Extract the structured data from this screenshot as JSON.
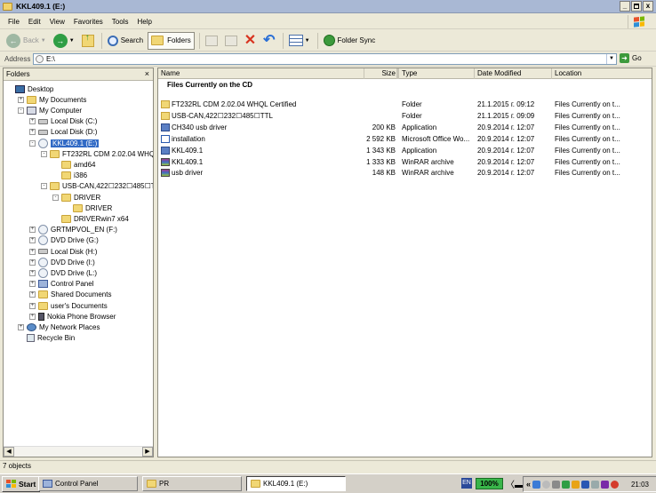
{
  "window": {
    "title": "KKL409.1 (E:)"
  },
  "window_buttons": [
    "_",
    " ",
    "x"
  ],
  "menu": [
    "File",
    "Edit",
    "View",
    "Favorites",
    "Tools",
    "Help"
  ],
  "toolbar": {
    "back_label": "Back",
    "search_label": "Search",
    "folders_label": "Folders",
    "folder_sync_label": "Folder Sync"
  },
  "address": {
    "label": "Address",
    "value": "E:\\",
    "go_label": "Go"
  },
  "folders_pane": {
    "title": "Folders",
    "close": "×",
    "tree": [
      {
        "label": "Desktop",
        "depth": 0,
        "toggle": "",
        "icon": "desktop-icon"
      },
      {
        "label": "My Documents",
        "depth": 1,
        "toggle": "+",
        "icon": "folder-icon"
      },
      {
        "label": "My Computer",
        "depth": 1,
        "toggle": "-",
        "icon": "computer-icon"
      },
      {
        "label": "Local Disk (C:)",
        "depth": 2,
        "toggle": "+",
        "icon": "drive-icon"
      },
      {
        "label": "Local Disk (D:)",
        "depth": 2,
        "toggle": "+",
        "icon": "drive-icon"
      },
      {
        "label": "KKL409.1 (E:)",
        "depth": 2,
        "toggle": "-",
        "icon": "cd-icon",
        "selected": true
      },
      {
        "label": "FT232RL CDM 2.02.04 WHQL Certified",
        "depth": 3,
        "toggle": "-",
        "icon": "folder-icon"
      },
      {
        "label": "amd64",
        "depth": 4,
        "toggle": "",
        "icon": "folder-icon"
      },
      {
        "label": "i386",
        "depth": 4,
        "toggle": "",
        "icon": "folder-icon"
      },
      {
        "label": "USB-CAN,422☐232☐485☐TTL",
        "depth": 3,
        "toggle": "-",
        "icon": "folder-icon"
      },
      {
        "label": "DRIVER",
        "depth": 4,
        "toggle": "-",
        "icon": "folder-icon"
      },
      {
        "label": "DRIVER",
        "depth": 5,
        "toggle": "",
        "icon": "folder-icon"
      },
      {
        "label": "DRIVERwin7 x64",
        "depth": 4,
        "toggle": "",
        "icon": "folder-icon"
      },
      {
        "label": "GRTMPVOL_EN (F:)",
        "depth": 2,
        "toggle": "+",
        "icon": "cd-icon"
      },
      {
        "label": "DVD Drive (G:)",
        "depth": 2,
        "toggle": "+",
        "icon": "cd-icon"
      },
      {
        "label": "Local Disk (H:)",
        "depth": 2,
        "toggle": "+",
        "icon": "drive-icon"
      },
      {
        "label": "DVD Drive (I:)",
        "depth": 2,
        "toggle": "+",
        "icon": "cd-icon"
      },
      {
        "label": "DVD Drive (L:)",
        "depth": 2,
        "toggle": "+",
        "icon": "cd-icon"
      },
      {
        "label": "Control Panel",
        "depth": 2,
        "toggle": "+",
        "icon": "control-panel-icon"
      },
      {
        "label": "Shared Documents",
        "depth": 2,
        "toggle": "+",
        "icon": "folder-icon"
      },
      {
        "label": "user's Documents",
        "depth": 2,
        "toggle": "+",
        "icon": "folder-icon"
      },
      {
        "label": "Nokia Phone Browser",
        "depth": 2,
        "toggle": "+",
        "icon": "phone-icon"
      },
      {
        "label": "My Network Places",
        "depth": 1,
        "toggle": "+",
        "icon": "network-icon"
      },
      {
        "label": "Recycle Bin",
        "depth": 1,
        "toggle": "",
        "icon": "recycle-bin-icon"
      }
    ]
  },
  "files": {
    "columns": [
      "Name",
      "Size",
      "Type",
      "Date Modified",
      "Location"
    ],
    "group_title": "Files Currently on the CD",
    "rows": [
      {
        "name": "FT232RL CDM 2.02.04 WHQL Certified",
        "size": "",
        "type": "Folder",
        "date": "21.1.2015 г. 09:12",
        "location": "Files Currently on t...",
        "icon": "folder-icon"
      },
      {
        "name": "USB-CAN,422☐232☐485☐TTL",
        "size": "",
        "type": "Folder",
        "date": "21.1.2015 г. 09:09",
        "location": "Files Currently on t...",
        "icon": "folder-icon"
      },
      {
        "name": "CH340 usb driver",
        "size": "200 KB",
        "type": "Application",
        "date": "20.9.2014 г. 12:07",
        "location": "Files Currently on t...",
        "icon": "application-icon"
      },
      {
        "name": "installation",
        "size": "2 592 KB",
        "type": "Microsoft Office Wo...",
        "date": "20.9.2014 г. 12:07",
        "location": "Files Currently on t...",
        "icon": "word-document-icon"
      },
      {
        "name": "KKL409.1",
        "size": "1 343 KB",
        "type": "Application",
        "date": "20.9.2014 г. 12:07",
        "location": "Files Currently on t...",
        "icon": "application-icon"
      },
      {
        "name": "KKL409.1",
        "size": "1 333 KB",
        "type": "WinRAR archive",
        "date": "20.9.2014 г. 12:07",
        "location": "Files Currently on t...",
        "icon": "winrar-icon"
      },
      {
        "name": "usb driver",
        "size": "148 KB",
        "type": "WinRAR archive",
        "date": "20.9.2014 г. 12:07",
        "location": "Files Currently on t...",
        "icon": "winrar-icon"
      }
    ]
  },
  "status": {
    "text": "7 objects"
  },
  "taskbar": {
    "start_label": "Start",
    "tasks": [
      {
        "label": "Control Panel",
        "active": false
      },
      {
        "label": "PR",
        "active": false
      },
      {
        "label": "KKL409.1 (E:)",
        "active": true
      }
    ],
    "language": "EN",
    "battery": "100%",
    "clock": "21:03"
  },
  "colors": {
    "selection": "#316ac5",
    "folder": "#f1d775",
    "battery": "#39b54a",
    "back_button": "#2f9e44",
    "undo": "#2a6fd6",
    "delete": "#d8331f"
  }
}
